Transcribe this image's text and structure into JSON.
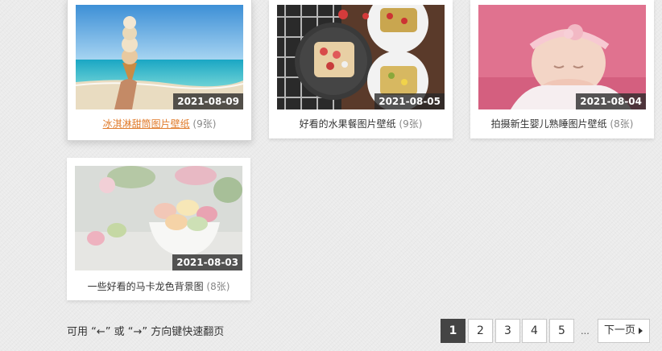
{
  "gallery": {
    "items": [
      {
        "title": "冰淇淋甜筒图片壁纸",
        "count": "(9张)",
        "date": "2021-08-09"
      },
      {
        "title": "好看的水果餐图片壁纸",
        "count": "(9张)",
        "date": "2021-08-05"
      },
      {
        "title": "拍摄新生婴儿熟睡图片壁纸",
        "count": "(8张)",
        "date": "2021-08-04"
      },
      {
        "title": "一些好看的马卡龙色背景图",
        "count": "(8张)",
        "date": "2021-08-03"
      }
    ]
  },
  "footer": {
    "hint": "可用 “←” 或 “→” 方向键快速翻页"
  },
  "pagination": {
    "pages": [
      "1",
      "2",
      "3",
      "4",
      "5"
    ],
    "current": "1",
    "ellipsis": "...",
    "next_label": "下一页",
    "next_icon": "caret-right-icon"
  },
  "colors": {
    "active_link": "#e07b2b",
    "current_page_bg": "#444444",
    "date_badge_bg": "#282828"
  }
}
